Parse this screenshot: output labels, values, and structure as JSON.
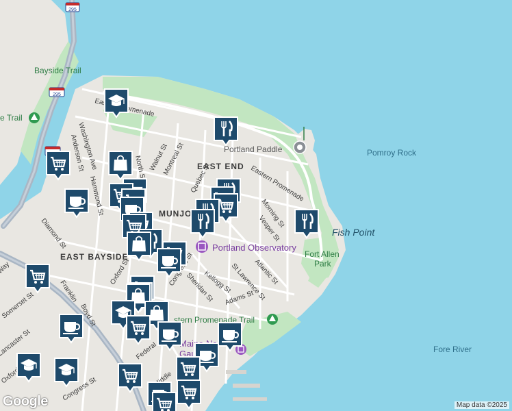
{
  "map": {
    "attribution": "Map data ©2025",
    "logo": "Google",
    "colors": {
      "water": "#8fd4e8",
      "land": "#e9e7e2",
      "park": "#c2e6c1",
      "road": "#ffffff",
      "highway": "#a9b6c4",
      "pin": "#1e4a6b",
      "poi_purple": "#7a3fa0"
    },
    "labels": {
      "areas": [
        {
          "text": "EAST END"
        },
        {
          "text": "MUNJOY"
        },
        {
          "text": "EAST BAYSIDE"
        }
      ],
      "water": [
        {
          "text": "Pomroy Rock"
        },
        {
          "text": "Fish Point"
        },
        {
          "text": "Fore River"
        }
      ],
      "parks": [
        {
          "text": "Bayside Trail"
        },
        {
          "text": "e Trail"
        },
        {
          "text": "Fort Allen"
        },
        {
          "text": "Park"
        },
        {
          "text": "stern Promenade Trail"
        }
      ],
      "pois": [
        {
          "text": "Portland Paddle"
        },
        {
          "text": "Portland Observatory"
        },
        {
          "text": "Maine Nar"
        },
        {
          "text": "Gauge R"
        }
      ],
      "streets": [
        {
          "text": "Eastern Promenade"
        },
        {
          "text": "Eastern Promenade"
        },
        {
          "text": "Washington Ave"
        },
        {
          "text": "Anderson St"
        },
        {
          "text": "Hammond St"
        },
        {
          "text": "North St"
        },
        {
          "text": "Walnut St"
        },
        {
          "text": "Montreal St"
        },
        {
          "text": "Quebec St"
        },
        {
          "text": "Morning St"
        },
        {
          "text": "Vesper St"
        },
        {
          "text": "Diamond St"
        },
        {
          "text": "Atlantic St"
        },
        {
          "text": "St Lawrence St"
        },
        {
          "text": "Kellogg St"
        },
        {
          "text": "Adams St"
        },
        {
          "text": "Sheridan St"
        },
        {
          "text": "Congress St"
        },
        {
          "text": "Oxford St"
        },
        {
          "text": "Boyd St"
        },
        {
          "text": "Franklin"
        },
        {
          "text": "Somerset St"
        },
        {
          "text": "Lancaster St"
        },
        {
          "text": "Oxford"
        },
        {
          "text": "Congress St"
        },
        {
          "text": "Middle"
        },
        {
          "text": "Federal"
        },
        {
          "text": "Way"
        }
      ],
      "highway_shield": "295"
    },
    "pins": [
      {
        "type": "school",
        "icon": "graduation-cap-icon"
      },
      {
        "type": "restaurant",
        "icon": "fork-knife-icon"
      },
      {
        "type": "grocery",
        "icon": "shopping-cart-icon"
      },
      {
        "type": "shop",
        "icon": "shopping-bag-icon"
      },
      {
        "type": "cafe",
        "icon": "coffee-cup-icon"
      }
    ]
  }
}
